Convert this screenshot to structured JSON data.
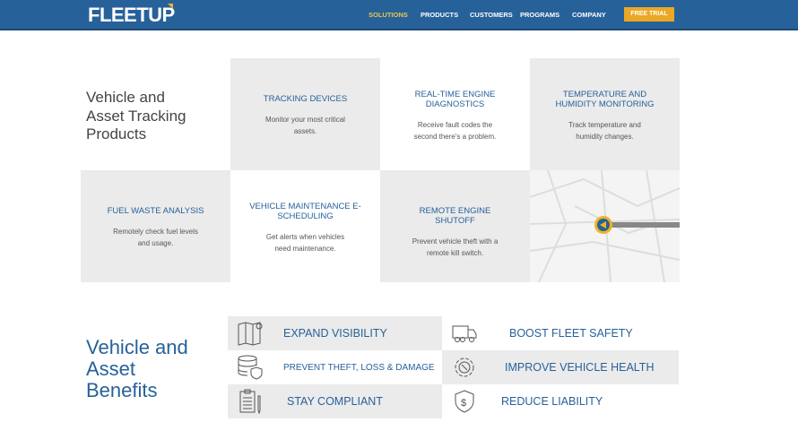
{
  "header": {
    "logo": "FLEETUP",
    "nav": [
      "SOLUTIONS",
      "PRODUCTS",
      "CUSTOMERS",
      "PROGRAMS",
      "COMPANY"
    ],
    "cta": "FREE TRIAL",
    "active_color": "#e8c84a"
  },
  "products": {
    "title": "Vehicle and Asset Tracking Products",
    "cards": [
      {
        "title": "TRACKING DEVICES",
        "desc": "Monitor your most critical assets."
      },
      {
        "title": "REAL-TIME ENGINE DIAGNOSTICS",
        "desc": "Receive fault codes the second there's a problem."
      },
      {
        "title": "TEMPERATURE AND HUMIDITY MONITORING",
        "desc": "Track temperature and humidity changes."
      },
      {
        "title": "FUEL WASTE ANALYSIS",
        "desc": "Remotely check fuel levels and usage."
      },
      {
        "title": "VEHICLE MAINTENANCE E-SCHEDULING",
        "desc": "Get alerts when vehicles need maintenance."
      },
      {
        "title": "REMOTE ENGINE SHUTOFF",
        "desc": "Prevent vehicle theft with a remote kill switch."
      }
    ]
  },
  "benefits": {
    "title": "Vehicle and Asset Benefits",
    "items": [
      {
        "label": "EXPAND VISIBILITY",
        "icon": "map-pin-icon"
      },
      {
        "label": "BOOST FLEET SAFETY",
        "icon": "truck-icon"
      },
      {
        "label": "PREVENT THEFT, LOSS & DAMAGE",
        "icon": "database-shield-icon"
      },
      {
        "label": "IMPROVE VEHICLE HEALTH",
        "icon": "gear-wrench-icon"
      },
      {
        "label": "STAY COMPLIANT",
        "icon": "clipboard-icon"
      },
      {
        "label": "REDUCE LIABILITY",
        "icon": "shield-dollar-icon"
      }
    ]
  }
}
